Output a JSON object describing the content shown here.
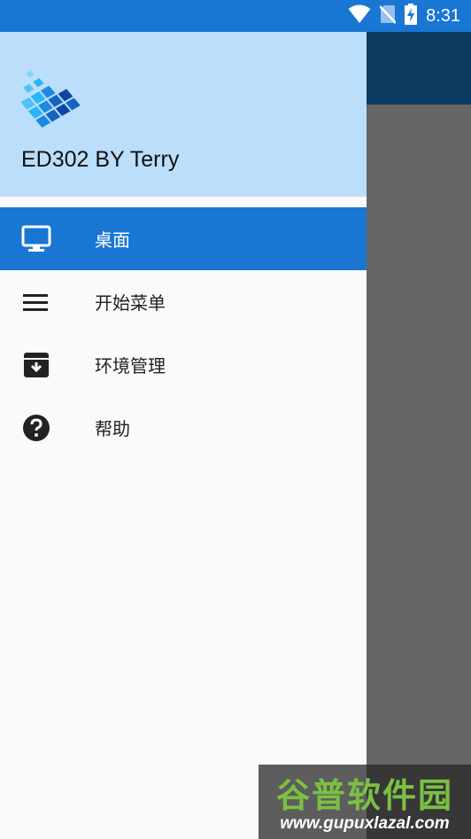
{
  "status_bar": {
    "time": "8:31",
    "icons": [
      "wifi-icon",
      "no-sim-icon",
      "battery-charging-icon"
    ]
  },
  "drawer": {
    "header": {
      "title": "ED302 BY Terry",
      "logo": "exagear-grid-logo"
    },
    "items": [
      {
        "label": "桌面",
        "icon": "monitor-icon",
        "active": true
      },
      {
        "label": "开始菜单",
        "icon": "menu-lines-icon",
        "active": false
      },
      {
        "label": "环境管理",
        "icon": "archive-box-icon",
        "active": false
      },
      {
        "label": "帮助",
        "icon": "help-circle-icon",
        "active": false
      }
    ]
  },
  "colors": {
    "status_bar": "#1976d2",
    "drawer_header": "#bbdefb",
    "active_item": "#1976d2",
    "app_toolbar": "#0d3b5f",
    "scrim": "#666666"
  },
  "watermark": {
    "name": "谷普软件园",
    "url": "www.gupuxlazal.com"
  }
}
